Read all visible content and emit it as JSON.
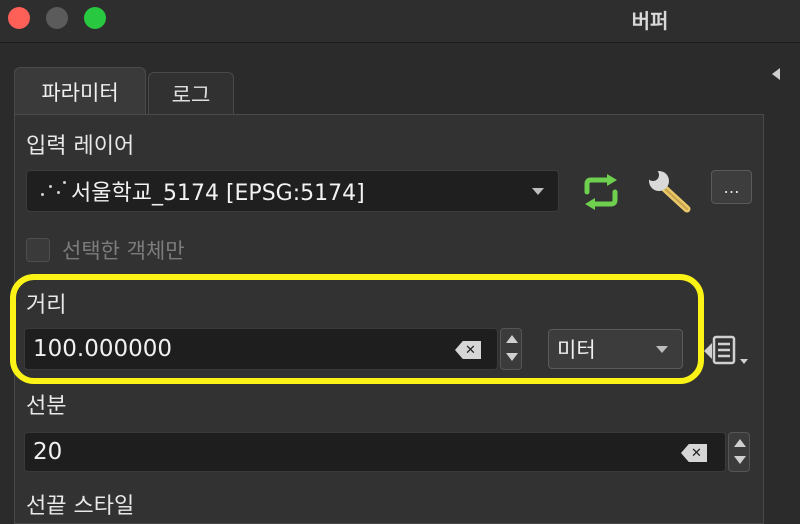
{
  "window": {
    "title": "버퍼"
  },
  "tabs": [
    {
      "label": "파라미터"
    },
    {
      "label": "로그"
    }
  ],
  "input_layer": {
    "label": "입력 레이어",
    "value": "서울학교_5174 [EPSG:5174]",
    "more_label": "…"
  },
  "selected_only": {
    "label": "선택한 객체만",
    "checked": false
  },
  "distance": {
    "label": "거리",
    "value": "100.000000",
    "unit": "미터"
  },
  "segments": {
    "label": "선분",
    "value": "20"
  },
  "end_cap": {
    "label": "선끝 스타일"
  },
  "colors": {
    "highlight": "#fbf316",
    "accent_green": "#6fcf4f"
  }
}
